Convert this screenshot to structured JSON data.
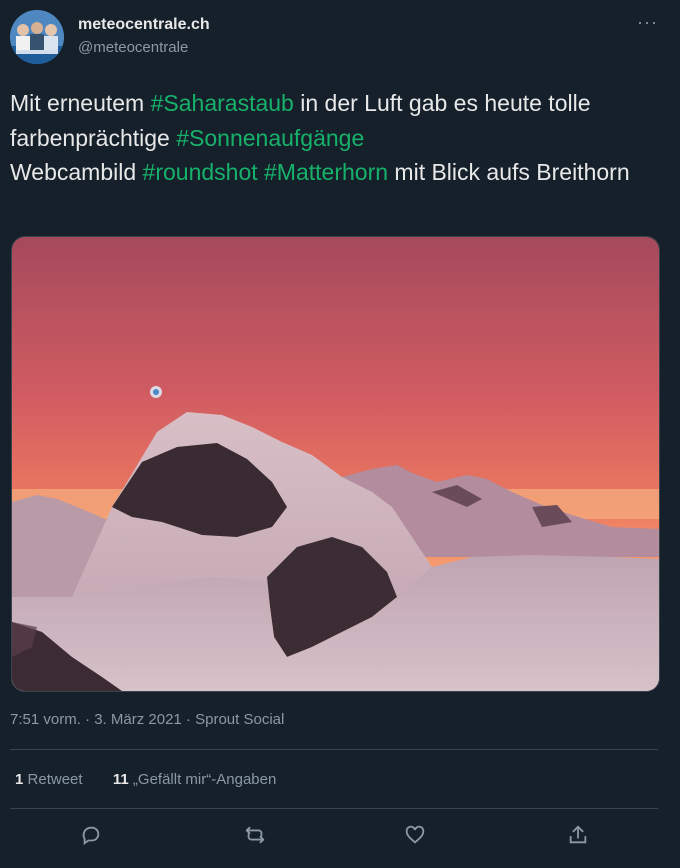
{
  "author": {
    "name": "meteocentrale.ch",
    "handle": "@meteocentrale",
    "avatar_icon": "team-photo-avatar"
  },
  "menu_icon": "more-icon",
  "tweet": {
    "segments": [
      {
        "text": "Mit erneutem ",
        "tag": false
      },
      {
        "text": "#Saharastaub",
        "tag": true
      },
      {
        "text": " in der Luft gab es heute tolle farbenprächtige ",
        "tag": false
      },
      {
        "text": "#Sonnenaufgänge",
        "tag": true
      },
      {
        "text": "\nWebcambild ",
        "tag": false
      },
      {
        "text": "#roundshot",
        "tag": true
      },
      {
        "text": " ",
        "tag": false
      },
      {
        "text": "#Matterhorn",
        "tag": true
      },
      {
        "text": " mit Blick aufs Breithorn",
        "tag": false
      }
    ],
    "hashtag_color": "#17b26a"
  },
  "media": {
    "kind": "photo",
    "subject": "mountain-sunrise"
  },
  "meta": {
    "time": "7:51 vorm.",
    "sep1": " · ",
    "date": "3. März 2021",
    "sep2": " · ",
    "source": "Sprout Social"
  },
  "stats": {
    "retweets_count": "1",
    "retweets_label": "Retweet",
    "likes_count": "11",
    "likes_label": "„Gefällt mir“-Angaben"
  },
  "actions": [
    {
      "name": "reply-icon"
    },
    {
      "name": "retweet-icon"
    },
    {
      "name": "like-icon"
    },
    {
      "name": "share-icon"
    }
  ],
  "colors": {
    "background": "#15202b",
    "divider": "#38444d",
    "muted": "#8b98a5"
  }
}
